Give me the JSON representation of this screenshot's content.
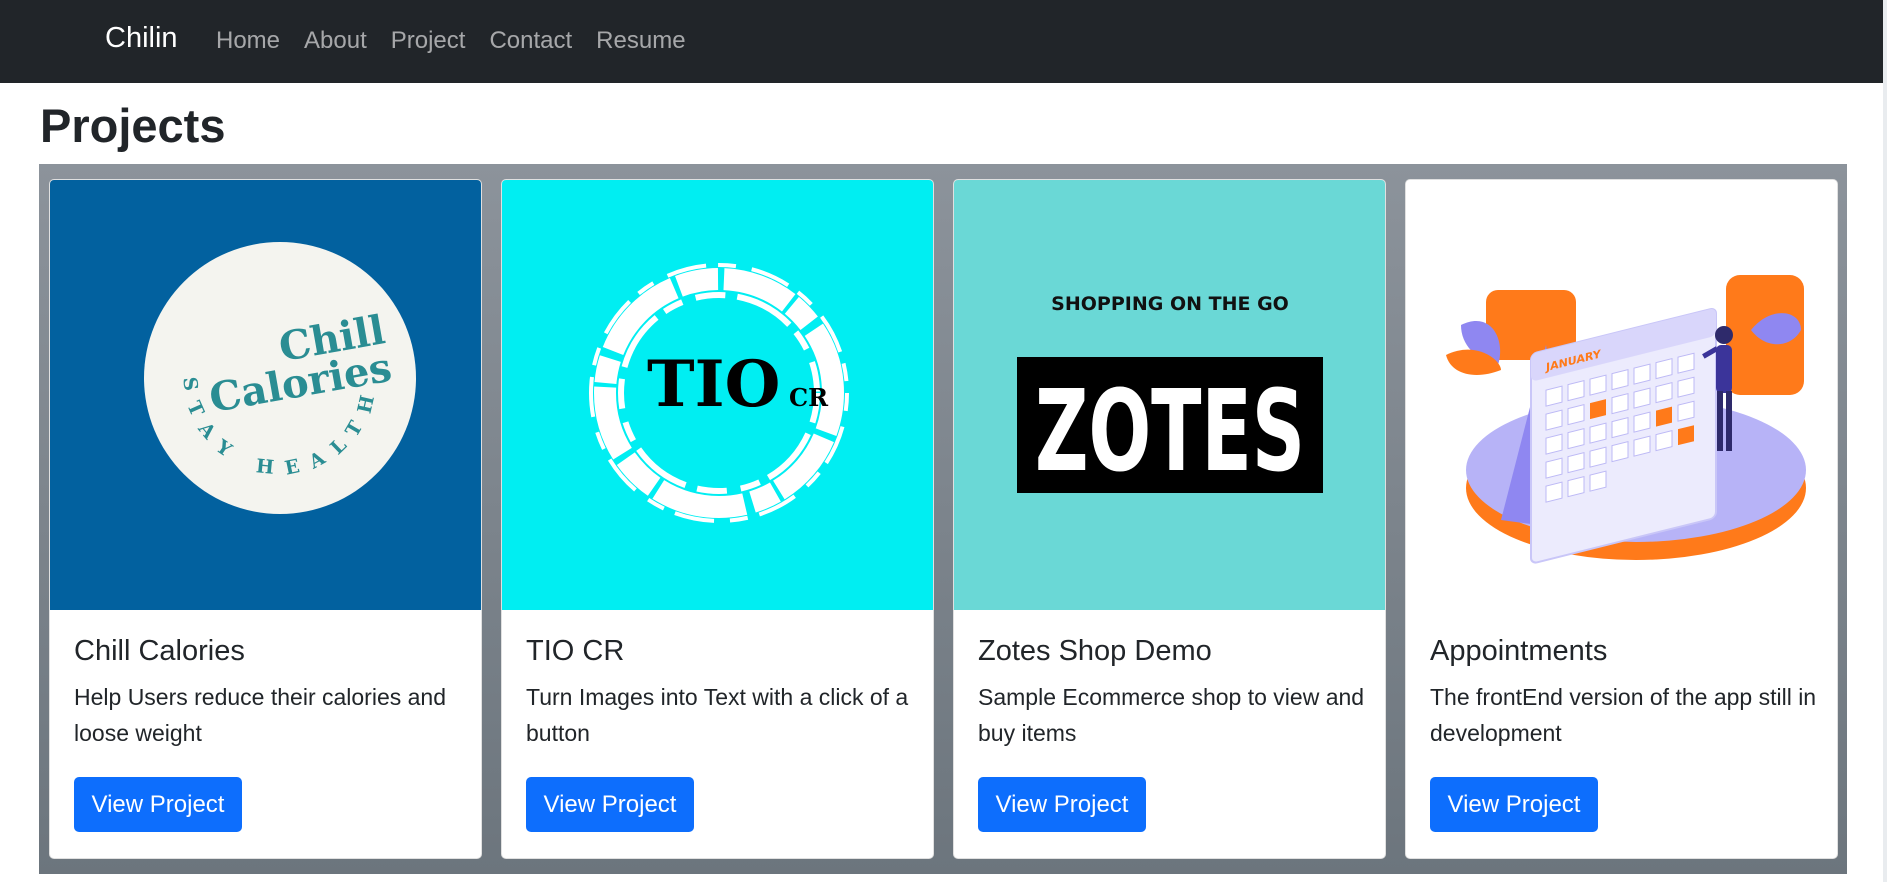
{
  "navbar": {
    "brand": "Chilin",
    "links": [
      "Home",
      "About",
      "Project",
      "Contact",
      "Resume"
    ]
  },
  "page": {
    "title": "Projects"
  },
  "projects": [
    {
      "title": "Chill Calories",
      "description": "Help Users reduce their calories and loose weight",
      "button": "View Project",
      "logo": {
        "line1": "Chill",
        "line2": "Calories",
        "ring": "STAY HEALTHY",
        "bg": "#02619f",
        "accent": "#2a8d93"
      }
    },
    {
      "title": "TIO CR",
      "description": "Turn Images into Text with a click of a button",
      "button": "View Project",
      "logo": {
        "main": "TIO",
        "sub": "CR",
        "bg": "#00eef2"
      }
    },
    {
      "title": "Zotes Shop Demo",
      "description": "Sample Ecommerce shop to view and buy items",
      "button": "View Project",
      "logo": {
        "tagline": "SHOPPING ON THE GO",
        "main": "ZOTES",
        "bg": "#6ad8d6"
      }
    },
    {
      "title": "Appointments",
      "description": "The frontEnd version of the app still in development",
      "button": "View Project",
      "logo": {
        "month": "JANUARY",
        "accent": "#ff7a1a",
        "primary": "#8f87f1"
      }
    }
  ],
  "colors": {
    "navbar_bg": "#212529",
    "primary_button": "#0d6efd",
    "panel_bg": "#6c757d"
  }
}
